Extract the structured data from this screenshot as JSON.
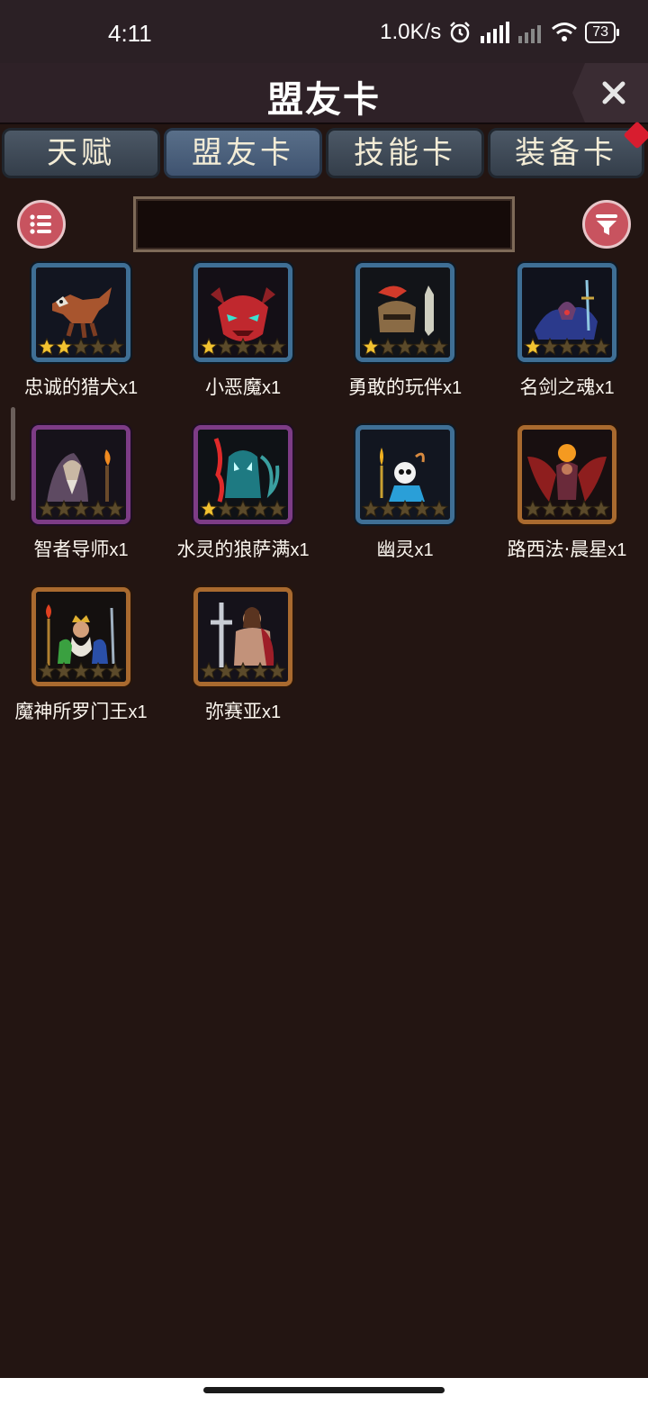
{
  "status_bar": {
    "time": "4:11",
    "network_speed": "1.0K/s",
    "battery_level": "73"
  },
  "header": {
    "title": "盟友卡"
  },
  "tabs": [
    {
      "label": "天赋",
      "active": false
    },
    {
      "label": "盟友卡",
      "active": true
    },
    {
      "label": "技能卡",
      "active": false
    },
    {
      "label": "装备卡",
      "active": false,
      "badge": true
    }
  ],
  "toolbar": {
    "search_value": ""
  },
  "cards": [
    {
      "name": "忠诚的猎犬",
      "qty": "x1",
      "frame": "blue",
      "stars": 2,
      "art": "hound"
    },
    {
      "name": "小恶魔",
      "qty": "x1",
      "frame": "blue",
      "stars": 1,
      "art": "imp"
    },
    {
      "name": "勇敢的玩伴",
      "qty": "x1",
      "frame": "blue",
      "stars": 1,
      "art": "knight"
    },
    {
      "name": "名剑之魂",
      "qty": "x1",
      "frame": "blue",
      "stars": 1,
      "art": "sword-spirit"
    },
    {
      "name": "智者导师",
      "qty": "x1",
      "frame": "purple",
      "stars": 0,
      "art": "sage"
    },
    {
      "name": "水灵的狼萨满",
      "qty": "x1",
      "frame": "purple",
      "stars": 1,
      "art": "shaman"
    },
    {
      "name": "幽灵",
      "qty": "x1",
      "frame": "blue",
      "stars": 0,
      "art": "ghost"
    },
    {
      "name": "路西法·晨星",
      "qty": "x1",
      "frame": "orange",
      "stars": 0,
      "art": "lucifer"
    },
    {
      "name": "魔神所罗门王",
      "qty": "x1",
      "frame": "orange",
      "stars": 0,
      "art": "solomon"
    },
    {
      "name": "弥赛亚",
      "qty": "x1",
      "frame": "orange",
      "stars": 0,
      "art": "messiah"
    }
  ],
  "colors": {
    "background": "#231512",
    "accent_button": "#c8535f",
    "star_filled": "#f2c230",
    "star_empty": "#5b4a2a"
  }
}
